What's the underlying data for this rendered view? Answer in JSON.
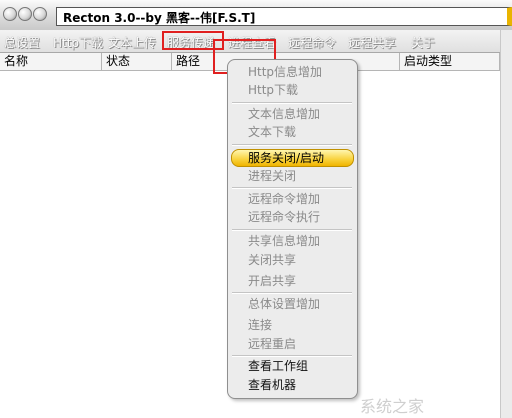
{
  "window": {
    "title": "Recton 3.0--by 黑客--伟[F.S.T]"
  },
  "menubar": {
    "items": [
      {
        "label": "总设置"
      },
      {
        "label": "Http下载"
      },
      {
        "label": "文本上传"
      },
      {
        "label": "服务传递"
      },
      {
        "label": "进程查看"
      },
      {
        "label": "远程命令"
      },
      {
        "label": "远程共享"
      },
      {
        "label": "关于"
      }
    ]
  },
  "list": {
    "columns": [
      "名称",
      "状态",
      "路径",
      "启动类型"
    ]
  },
  "dropdown": {
    "items": [
      {
        "label": "Http信息增加",
        "enabled": false
      },
      {
        "label": "Http下载",
        "enabled": false
      },
      {
        "label": "文本信息增加",
        "enabled": false
      },
      {
        "label": "文本下载",
        "enabled": false
      },
      {
        "label": "服务关闭/启动",
        "enabled": true,
        "highlighted": true
      },
      {
        "label": "进程关闭",
        "enabled": false
      },
      {
        "label": "远程命令增加",
        "enabled": false
      },
      {
        "label": "远程命令执行",
        "enabled": false
      },
      {
        "label": "共享信息增加",
        "enabled": false
      },
      {
        "label": "关闭共享",
        "enabled": false
      },
      {
        "label": "开启共享",
        "enabled": false
      },
      {
        "label": "总体设置增加",
        "enabled": false
      },
      {
        "label": "连接",
        "enabled": false
      },
      {
        "label": "远程重启",
        "enabled": false
      },
      {
        "label": "查看工作组",
        "enabled": true
      },
      {
        "label": "查看机器",
        "enabled": true
      }
    ]
  },
  "colors": {
    "highlight": "#f8d13a",
    "annotation": "#e02020",
    "accent": "#e9b400"
  },
  "watermark": "系统之家"
}
